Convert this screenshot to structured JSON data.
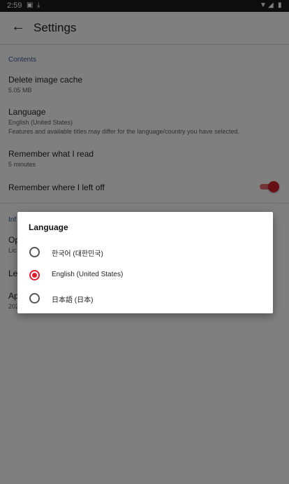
{
  "status": {
    "time": "2:59"
  },
  "appbar": {
    "title": "Settings"
  },
  "sections": {
    "contents": "Contents",
    "info_partial": "Inf"
  },
  "settings": {
    "cache": {
      "title": "Delete image cache",
      "value": "5.05 MB"
    },
    "language": {
      "title": "Language",
      "value": "English (United States)",
      "note": "Features and available titles may differ for the language/country you have selected."
    },
    "remember_read": {
      "title": "Remember what I read",
      "value": "5 minutes"
    },
    "remember_left": {
      "title": "Remember where I left off",
      "toggle_on": true
    }
  },
  "hidden_items": [
    {
      "title": "Op",
      "sub": "Lic"
    },
    {
      "title": "Le"
    },
    {
      "title": "Ap",
      "sub": "202"
    }
  ],
  "dialog": {
    "title": "Language",
    "options": [
      {
        "label": "한국어 (대한민국)",
        "selected": false
      },
      {
        "label": "English (United States)",
        "selected": true
      },
      {
        "label": "日本語 (日本)",
        "selected": false
      }
    ]
  },
  "colors": {
    "accent": "#e11d2e",
    "section_label": "#3b5998"
  }
}
